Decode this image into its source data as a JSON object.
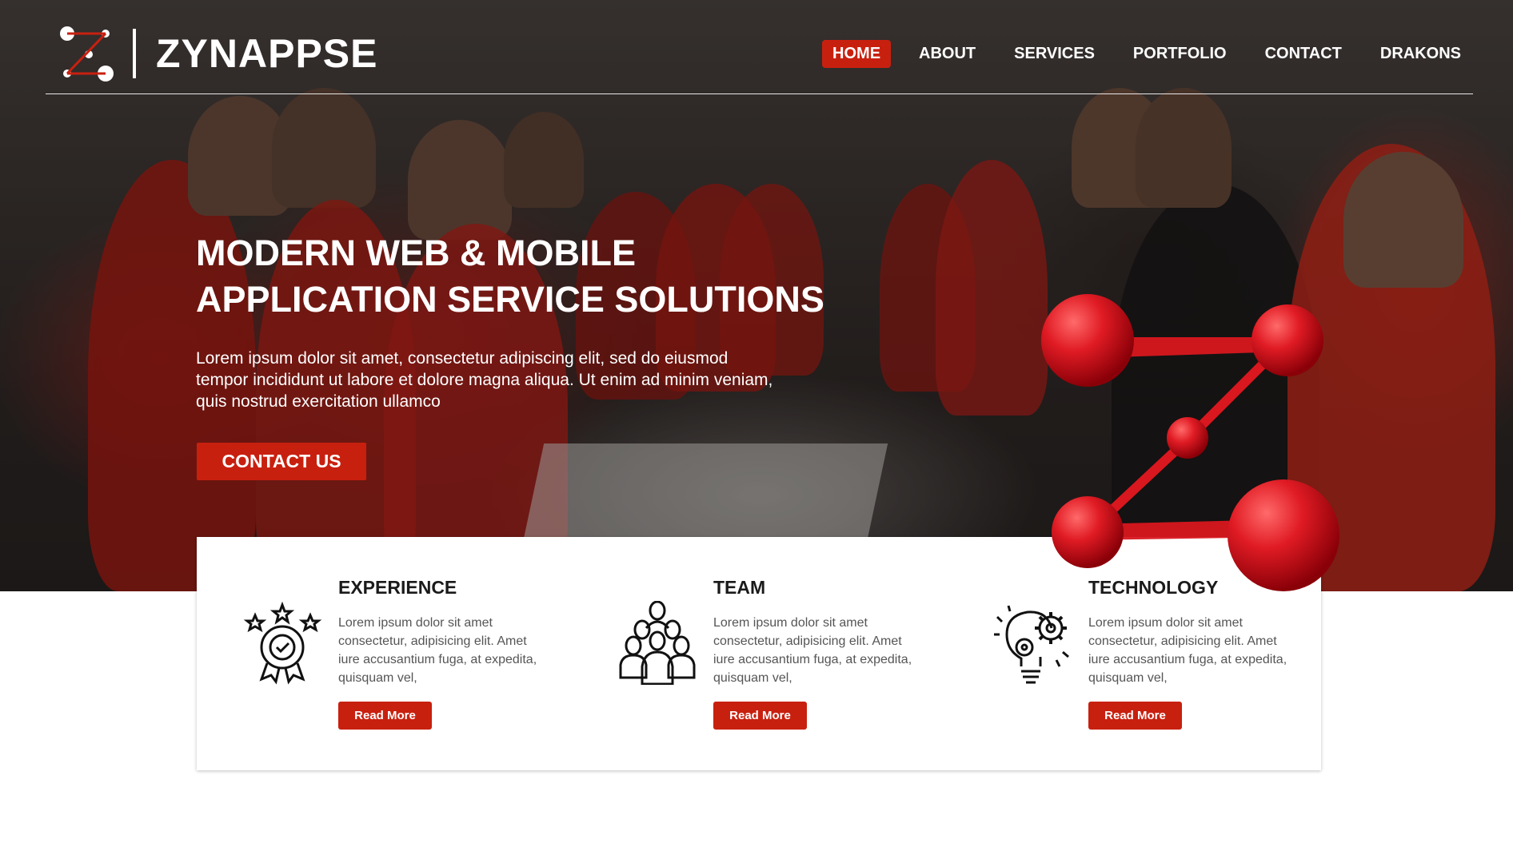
{
  "brand": {
    "name": "ZYNAPPSE"
  },
  "nav": {
    "items": [
      {
        "label": "HOME",
        "active": true
      },
      {
        "label": "ABOUT",
        "active": false
      },
      {
        "label": "SERVICES",
        "active": false
      },
      {
        "label": "PORTFOLIO",
        "active": false
      },
      {
        "label": "CONTACT",
        "active": false
      },
      {
        "label": "DRAKONS",
        "active": false
      }
    ]
  },
  "hero": {
    "title_line1": "MODERN WEB & MOBILE",
    "title_line2": "APPLICATION SERVICE SOLUTIONS",
    "description": "Lorem ipsum dolor sit amet, consectetur adipiscing elit, sed do eiusmod tempor incididunt ut labore et dolore magna aliqua. Ut enim ad minim veniam, quis nostrud exercitation ullamco",
    "cta_label": "CONTACT US"
  },
  "features": [
    {
      "title": "EXPERIENCE",
      "icon": "award-medal-icon",
      "text": "Lorem ipsum dolor sit amet consectetur, adipisicing elit. Amet iure accusantium fuga, at expedita, quisquam vel,",
      "button": "Read More"
    },
    {
      "title": "TEAM",
      "icon": "team-group-icon",
      "text": "Lorem ipsum dolor sit amet consectetur, adipisicing elit. Amet iure accusantium fuga, at expedita, quisquam vel,",
      "button": "Read More"
    },
    {
      "title": "TECHNOLOGY",
      "icon": "lightbulb-gear-icon",
      "text": "Lorem ipsum dolor sit amet consectetur, adipisicing elit. Amet iure accusantium fuga, at expedita, quisquam vel,",
      "button": "Read More"
    }
  ],
  "colors": {
    "accent": "#c8200f",
    "text_dark": "#1a1a1a",
    "text_muted": "#555555"
  }
}
